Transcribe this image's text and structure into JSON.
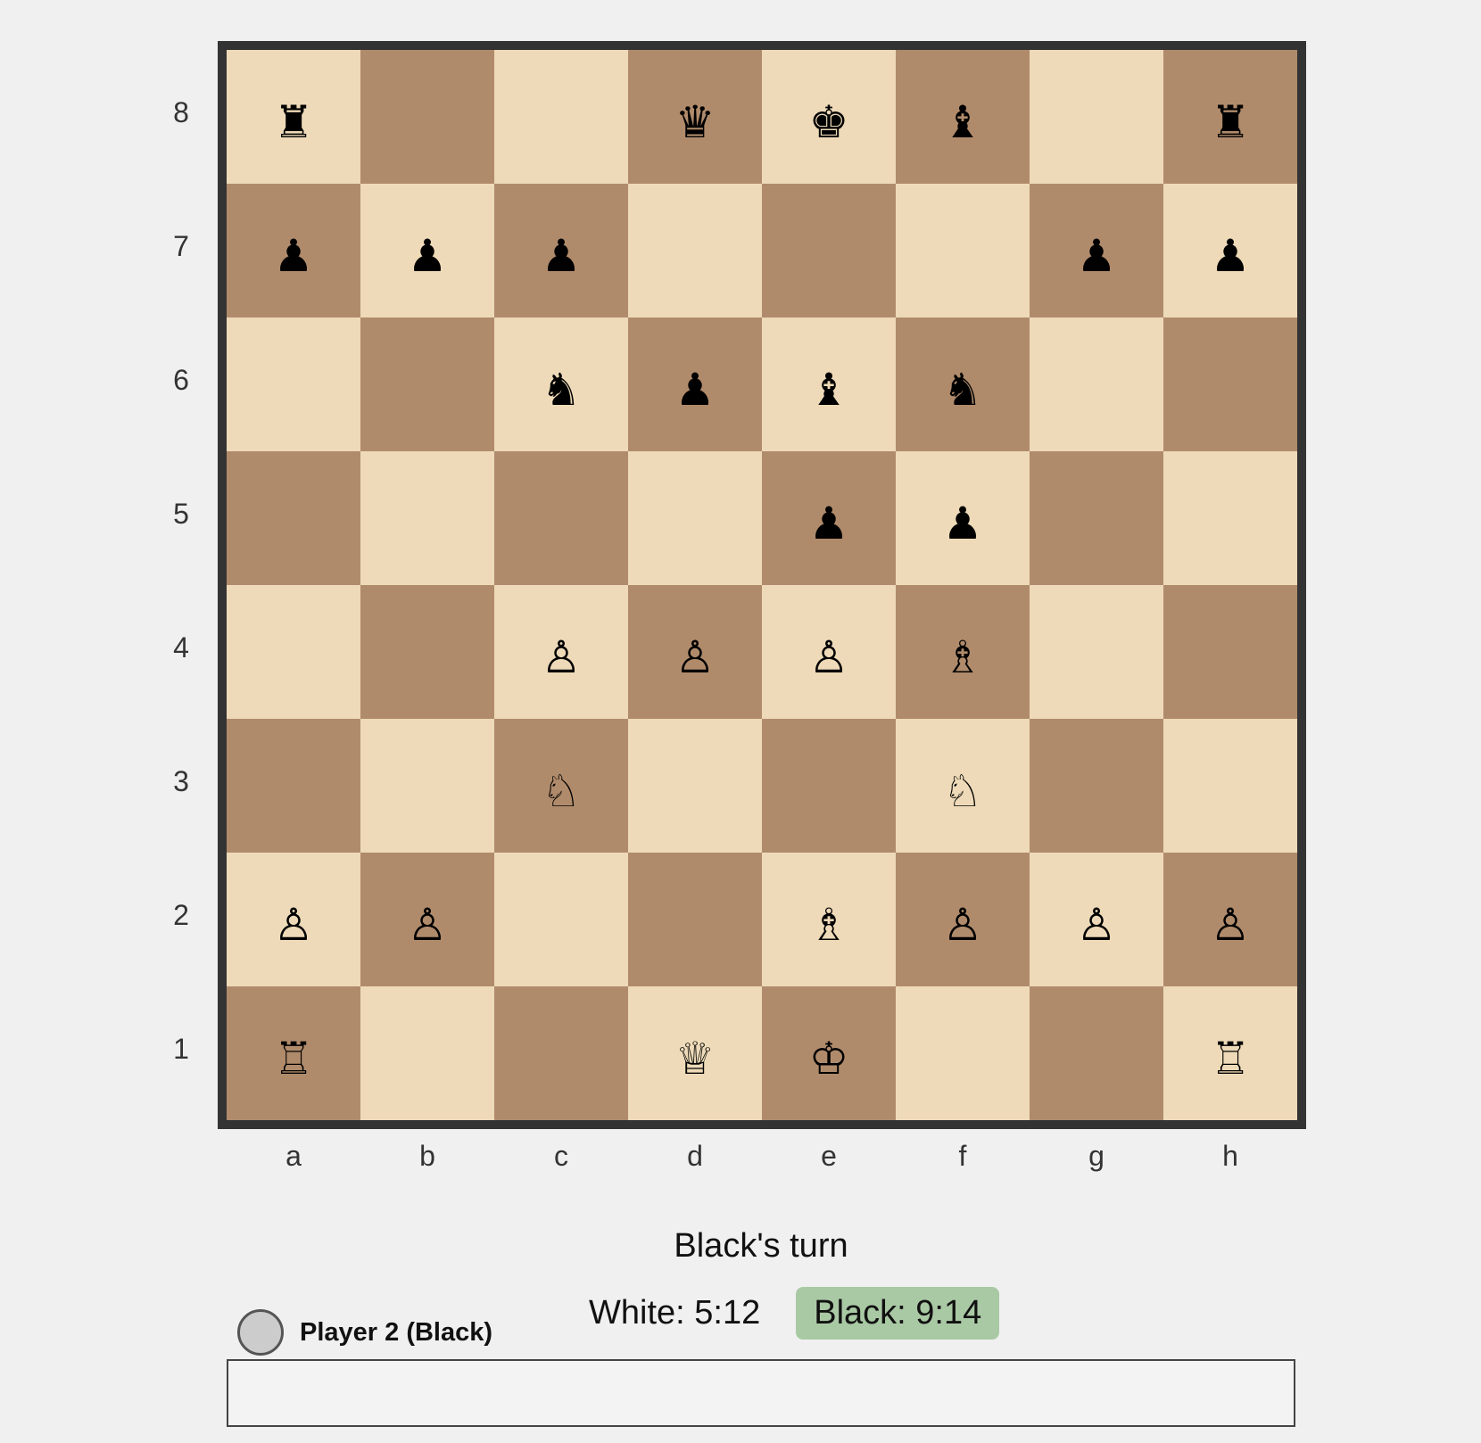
{
  "board": {
    "ranks": [
      "8",
      "7",
      "6",
      "5",
      "4",
      "3",
      "2",
      "1"
    ],
    "files": [
      "a",
      "b",
      "c",
      "d",
      "e",
      "f",
      "g",
      "h"
    ],
    "position": [
      [
        "♜",
        "",
        "",
        "♛",
        "♚",
        "♝",
        "",
        "♜"
      ],
      [
        "♟",
        "♟",
        "♟",
        "",
        "",
        "",
        "♟",
        "♟"
      ],
      [
        "",
        "",
        "♞",
        "♟",
        "♝",
        "♞",
        "",
        ""
      ],
      [
        "",
        "",
        "",
        "",
        "♟",
        "♟",
        "",
        ""
      ],
      [
        "",
        "",
        "♙",
        "♙",
        "♙",
        "♗",
        "",
        ""
      ],
      [
        "",
        "",
        "♘",
        "",
        "",
        "♘",
        "",
        ""
      ],
      [
        "♙",
        "♙",
        "",
        "",
        "♗",
        "♙",
        "♙",
        "♙"
      ],
      [
        "♖",
        "",
        "",
        "♕",
        "♔",
        "",
        "",
        "♖"
      ]
    ],
    "colors": {
      "light": "#eedab8",
      "dark": "#b08b6b",
      "frame": "#333333"
    }
  },
  "status": {
    "turn_text": "Black's turn",
    "white_clock": "White: 5:12",
    "black_clock": "Black: 9:14",
    "active_clock_color": "#a9c9a4"
  },
  "player": {
    "name": "Player 2 (Black)"
  },
  "move_input": {
    "value": ""
  }
}
